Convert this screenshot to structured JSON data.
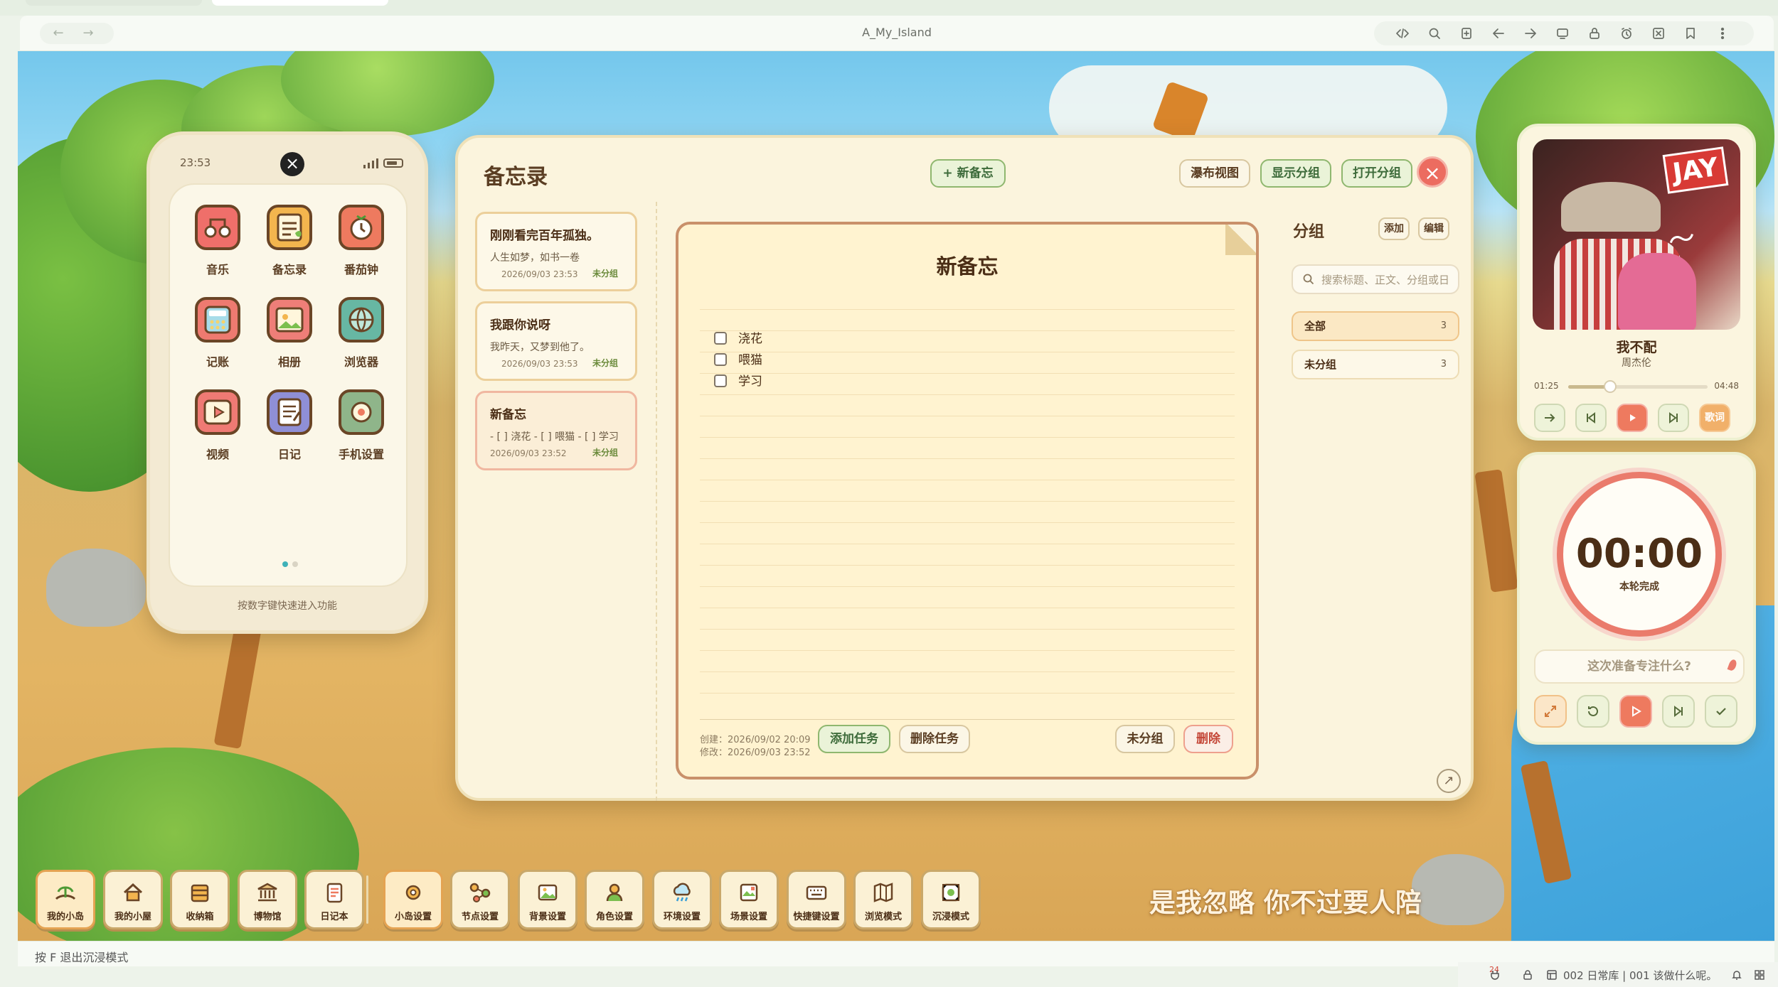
{
  "browser": {
    "window_title": "A_My_Island",
    "back_icon": "arrow-left-icon",
    "forward_icon": "arrow-right-icon",
    "toolbar_icons": [
      "code-icon",
      "search-icon",
      "bookmark-add-icon",
      "share-back-icon",
      "share-forward-icon",
      "screen-cast-icon",
      "lock-icon",
      "alarm-icon",
      "close-box-icon",
      "bookmark-icon",
      "more-icon"
    ]
  },
  "phone": {
    "time": "23:53",
    "apps": [
      {
        "label": "音乐",
        "icon": "music-icon",
        "color": "#ef6f6a"
      },
      {
        "label": "备忘录",
        "icon": "memo-icon",
        "color": "#f3b54e"
      },
      {
        "label": "番茄钟",
        "icon": "tomato-clock-icon",
        "color": "#ee7a5f"
      },
      {
        "label": "记账",
        "icon": "calculator-icon",
        "color": "#ee7a70"
      },
      {
        "label": "相册",
        "icon": "photo-icon",
        "color": "#ee7e78"
      },
      {
        "label": "浏览器",
        "icon": "globe-icon",
        "color": "#67b7a3"
      },
      {
        "label": "视频",
        "icon": "video-icon",
        "color": "#ef7a74"
      },
      {
        "label": "日记",
        "icon": "diary-icon",
        "color": "#8f8fd6"
      },
      {
        "label": "手机设置",
        "icon": "settings-icon",
        "color": "#8fb58a"
      }
    ],
    "hint": "按数字键快速进入功能"
  },
  "memo": {
    "title": "备忘录",
    "new_button": "+ 新备忘",
    "view_buttons": [
      "瀑布视图",
      "显示分组",
      "打开分组"
    ],
    "notes": [
      {
        "title": "刚刚看完百年孤独。",
        "preview": "人生如梦，如书一卷",
        "date": "2026/09/03 23:53",
        "group": "未分组"
      },
      {
        "title": "我跟你说呀",
        "preview": "我昨天，又梦到他了。",
        "date": "2026/09/03 23:53",
        "group": "未分组"
      },
      {
        "title": "新备忘",
        "preview": "- [ ] 浇花 - [ ] 喂猫 - [ ] 学习",
        "date": "2026/09/03 23:52",
        "group": "未分组"
      }
    ],
    "editor": {
      "title": "新备忘",
      "todos": [
        "浇花",
        "喂猫",
        "学习"
      ],
      "created": "创建：2026/09/02 20:09",
      "modified": "修改：2026/09/03 23:52",
      "add_task": "添加任务",
      "delete_task": "删除任务",
      "group_button": "未分组",
      "delete_button": "删除"
    },
    "groups": {
      "title": "分组",
      "add": "添加",
      "edit": "编辑",
      "search_placeholder": "搜索标题、正文、分组或日",
      "items": [
        {
          "label": "全部",
          "count": "3"
        },
        {
          "label": "未分组",
          "count": "3"
        }
      ]
    }
  },
  "music": {
    "album_logo": "JAY",
    "song": "我不配",
    "artist": "周杰伦",
    "current": "01:25",
    "total": "04:48",
    "progress": 0.3,
    "lyrics_button": "歌词"
  },
  "timer": {
    "value": "00:00",
    "status": "本轮完成",
    "placeholder": "这次准备专注什么?"
  },
  "dock": {
    "items": [
      {
        "label": "我的小岛",
        "icon": "island-icon"
      },
      {
        "label": "我的小屋",
        "icon": "house-icon"
      },
      {
        "label": "收纳箱",
        "icon": "storage-box-icon"
      },
      {
        "label": "博物馆",
        "icon": "museum-icon"
      },
      {
        "label": "日记本",
        "icon": "notebook-icon"
      },
      {
        "label": "小岛设置",
        "icon": "gear-icon"
      },
      {
        "label": "节点设置",
        "icon": "node-icon"
      },
      {
        "label": "背景设置",
        "icon": "image-icon"
      },
      {
        "label": "角色设置",
        "icon": "character-icon"
      },
      {
        "label": "环境设置",
        "icon": "weather-icon"
      },
      {
        "label": "场景设置",
        "icon": "scene-icon"
      },
      {
        "label": "快捷键设置",
        "icon": "keyboard-icon"
      },
      {
        "label": "浏览模式",
        "icon": "map-icon"
      },
      {
        "label": "沉浸模式",
        "icon": "immersive-icon"
      }
    ]
  },
  "lyric": "是我忽略 你不过要人陪",
  "exit_hint": "按 F 退出沉浸模式",
  "status": {
    "badge": "24",
    "feed": "002 日常库 | 001 该做什么呢。"
  }
}
